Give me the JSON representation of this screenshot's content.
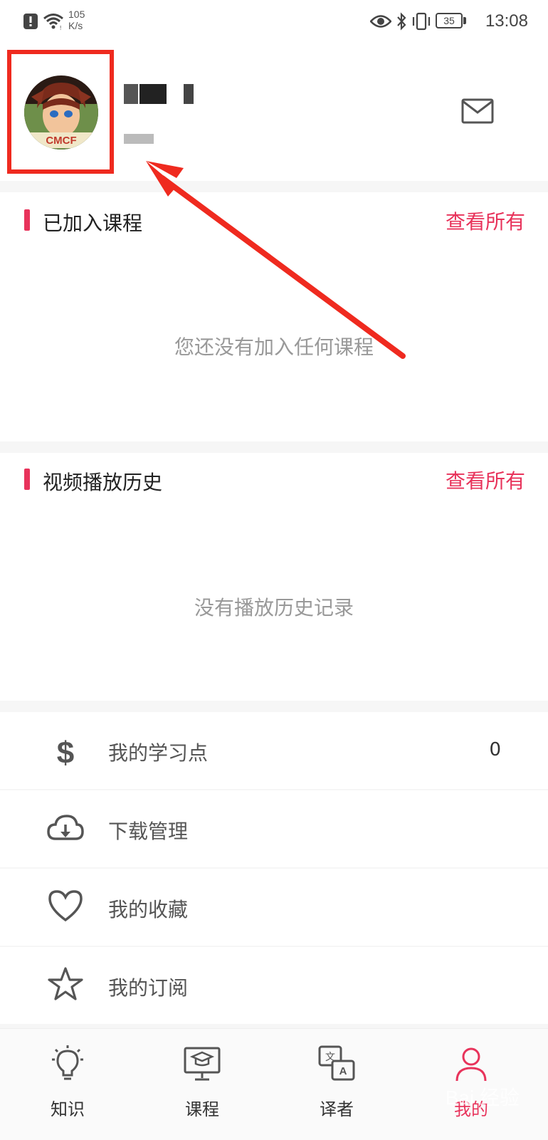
{
  "status_bar": {
    "net_speed_value": "105",
    "net_speed_unit": "K/s",
    "battery": "35",
    "time": "13:08"
  },
  "profile": {
    "avatar_text": "CMCF"
  },
  "sections": {
    "courses": {
      "title": "已加入课程",
      "view_all": "查看所有",
      "empty": "您还没有加入任何课程"
    },
    "history": {
      "title": "视频播放历史",
      "view_all": "查看所有",
      "empty": "没有播放历史记录"
    }
  },
  "menu": {
    "points": {
      "label": "我的学习点",
      "value": "0"
    },
    "downloads": {
      "label": "下载管理"
    },
    "favorites": {
      "label": "我的收藏"
    },
    "subscriptions": {
      "label": "我的订阅"
    }
  },
  "bottom_nav": {
    "knowledge": "知识",
    "courses": "课程",
    "translators": "译者",
    "mine": "我的"
  },
  "watermark": "Bai 经验",
  "colors": {
    "accent": "#e8335b",
    "annotation": "#ef2a1f"
  }
}
